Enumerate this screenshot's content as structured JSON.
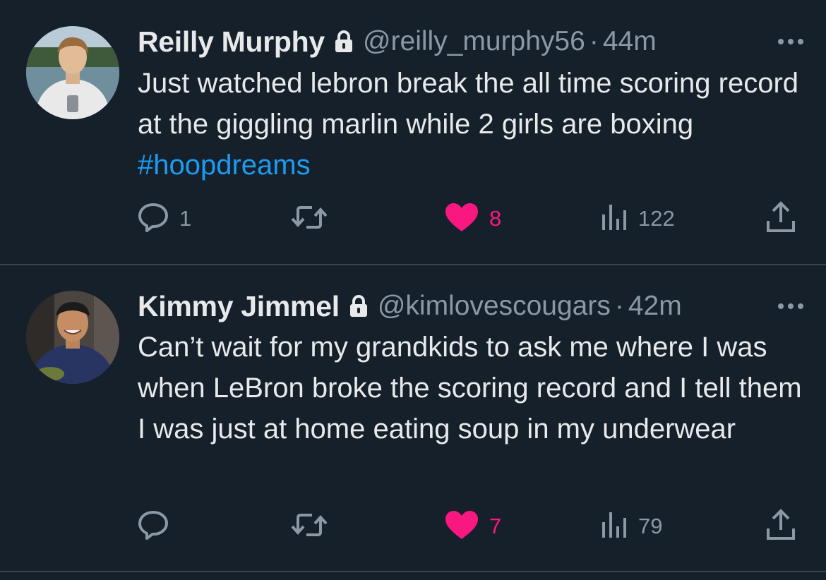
{
  "tweets": [
    {
      "name": "Reilly Murphy",
      "handle": "@reilly_murphy56",
      "separator": "·",
      "time": "44m",
      "text": "Just watched lebron break the all time scoring record at the giggling marlin while 2 girls are boxing ",
      "hashtag": "#hoopdreams",
      "reply_count": "1",
      "like_count": "8",
      "view_count": "122"
    },
    {
      "name": "Kimmy Jimmel",
      "handle": "@kimlovescougars",
      "separator": "·",
      "time": "42m",
      "text": "Can’t wait for my grandkids to ask me where I was when LeBron broke the scoring record and I tell them I was just at home eating soup in my underwear",
      "reply_count": "",
      "like_count": "7",
      "view_count": "79"
    }
  ],
  "colors": {
    "background": "#15202b",
    "primary_text": "#e7e9ea",
    "secondary_text": "#8b98a5",
    "hashtag": "#1d9bf0",
    "like": "#f91880",
    "divider": "#38444d"
  },
  "icons": [
    "lock-icon",
    "more-icon",
    "reply-icon",
    "retweet-icon",
    "like-icon",
    "views-icon",
    "share-icon"
  ]
}
